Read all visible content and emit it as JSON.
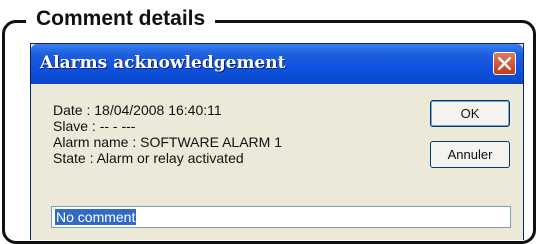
{
  "frame": {
    "title": "Comment details"
  },
  "dialog": {
    "title": "Alarms acknowledgement",
    "info": {
      "date": "Date : 18/04/2008 16:40:11",
      "slave": "Slave : -- - ---",
      "alarm_name": "Alarm name : SOFTWARE ALARM 1",
      "state": "State : Alarm or relay activated"
    },
    "ok_label": "OK",
    "cancel_label": "Annuler",
    "comment_value": "No comment"
  },
  "icons": {
    "close": "close-icon"
  },
  "colors": {
    "titlebar": "#0f52e0",
    "close": "#c4381c",
    "selection": "#316ac5"
  }
}
